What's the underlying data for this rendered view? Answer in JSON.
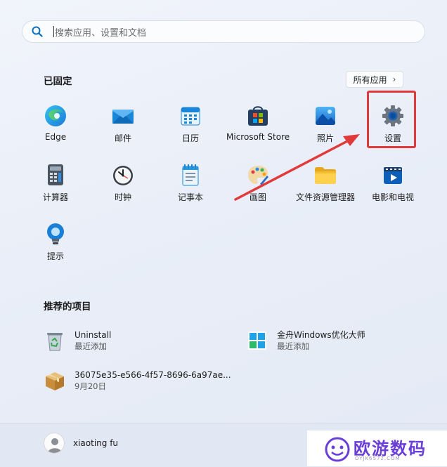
{
  "search": {
    "placeholder": "搜索应用、设置和文档"
  },
  "pinned": {
    "title": "已固定",
    "all_apps_label": "所有应用",
    "apps": [
      {
        "label": "Edge"
      },
      {
        "label": "邮件"
      },
      {
        "label": "日历"
      },
      {
        "label": "Microsoft Store"
      },
      {
        "label": "照片"
      },
      {
        "label": "设置"
      },
      {
        "label": "计算器"
      },
      {
        "label": "时钟"
      },
      {
        "label": "记事本"
      },
      {
        "label": "画图"
      },
      {
        "label": "文件资源管理器"
      },
      {
        "label": "电影和电视"
      },
      {
        "label": "提示"
      }
    ]
  },
  "recommended": {
    "title": "推荐的项目",
    "items": [
      {
        "name": "Uninstall",
        "sub": "最近添加"
      },
      {
        "name": "金舟Windows优化大师",
        "sub": "最近添加"
      },
      {
        "name": "36075e35-e566-4f57-8696-6a97ae...",
        "sub": "9月20日"
      }
    ]
  },
  "user": {
    "name": "xiaoting fu"
  },
  "watermark": {
    "text": "欧游数码",
    "sub": "OYJK6572.COM"
  },
  "colors": {
    "highlight": "#e03a3a",
    "accent": "#0067c0"
  }
}
